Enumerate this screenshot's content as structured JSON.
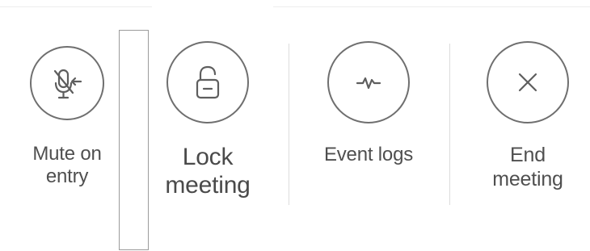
{
  "controls": [
    {
      "id": "mute-on-entry",
      "icon": "microphone-mute-arrow-icon",
      "label_line1": "Mute on",
      "label_line2": "entry"
    },
    {
      "id": "lock-meeting",
      "icon": "lock-open-icon",
      "label_line1": "Lock",
      "label_line2": "meeting"
    },
    {
      "id": "event-logs",
      "icon": "activity-pulse-icon",
      "label_line1": "Event logs",
      "label_line2": ""
    },
    {
      "id": "end-meeting",
      "icon": "close-x-icon",
      "label_line1": "End",
      "label_line2": "meeting"
    }
  ],
  "colors": {
    "icon_stroke": "#5e5e5e",
    "label_text": "#4f4f4f",
    "divider": "#dcdcdc",
    "focus_outline": "#9b9b9b"
  }
}
